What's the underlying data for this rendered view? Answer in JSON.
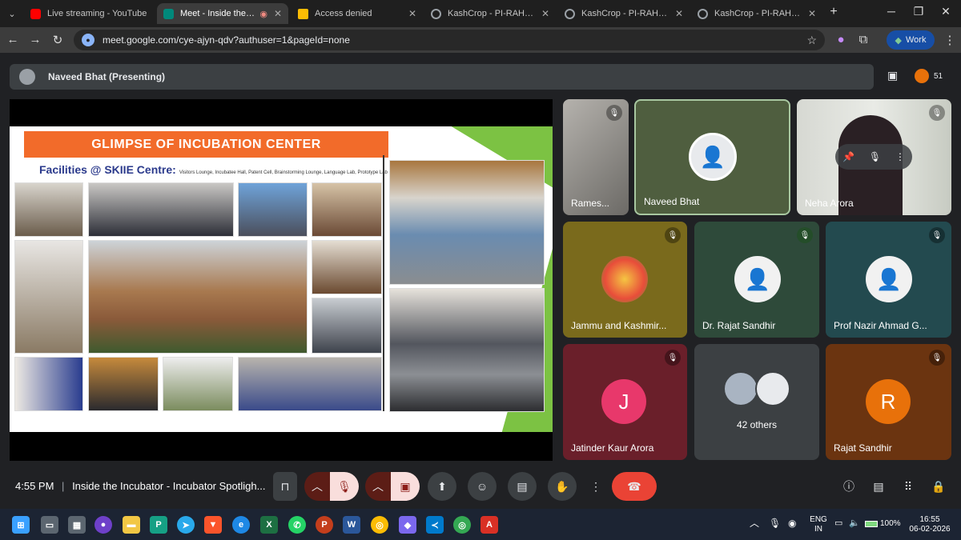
{
  "browser": {
    "tabs": [
      {
        "title": "Live streaming - YouTube",
        "color": "#ff0000",
        "active": false
      },
      {
        "title": "Meet - Inside the Incub",
        "color": "#00897b",
        "active": true
      },
      {
        "title": "Access denied",
        "color": "#fbbc04",
        "active": false
      },
      {
        "title": "KashCrop - PI-RAHI Showc",
        "color": "#9aa0a6",
        "active": false
      },
      {
        "title": "KashCrop - PI-RAHI Showc",
        "color": "#9aa0a6",
        "active": false
      },
      {
        "title": "KashCrop - PI-RAHI Showc",
        "color": "#9aa0a6",
        "active": false
      }
    ],
    "new_tab": "+",
    "url": "meet.google.com/cye-ajyn-qdv?authuser=1&pageId=none",
    "profile_label": "Work"
  },
  "meet": {
    "presenter_banner": "Naveed Bhat (Presenting)",
    "participant_count": "51",
    "slide": {
      "title": "GLIMPSE OF INCUBATION CENTER",
      "facilities": "Facilities @ SKIIE Centre:",
      "facilities_sub": "Visitors Lounge, Incubatee Hall, Patent Cell, Brainstorming Lounge, Language Lab, Prototype Lab"
    },
    "participants": [
      {
        "name": "Rames...",
        "tile_color": "#8d8a86"
      },
      {
        "name": "Naveed Bhat",
        "tile_color": "#4f5e3f"
      },
      {
        "name": "Neha Arora",
        "tile_color": "#cfd3cc"
      },
      {
        "name": "Jammu and Kashmir...",
        "tile_color": "#7a6a1c"
      },
      {
        "name": "Dr. Rajat Sandhir",
        "tile_color": "#2e4a3a"
      },
      {
        "name": "Prof Nazir Ahmad G...",
        "tile_color": "#234a4f"
      },
      {
        "name": "Jatinder Kaur Arora",
        "tile_color": "#6a1f2a",
        "initial": "J",
        "avatar_color": "#e8386b"
      },
      {
        "name": "42 others",
        "tile_color": "#3c4043"
      },
      {
        "name": "Rajat Sandhir",
        "tile_color": "#6b3410",
        "initial": "R",
        "avatar_color": "#e8710a"
      }
    ],
    "time": "4:55 PM",
    "meeting_title": "Inside the Incubator - Incubator Spotligh..."
  },
  "taskbar": {
    "lang": "ENG",
    "lang_sub": "IN",
    "battery": "100%",
    "clock_time": "16:55",
    "clock_date": "06-02-2026"
  }
}
